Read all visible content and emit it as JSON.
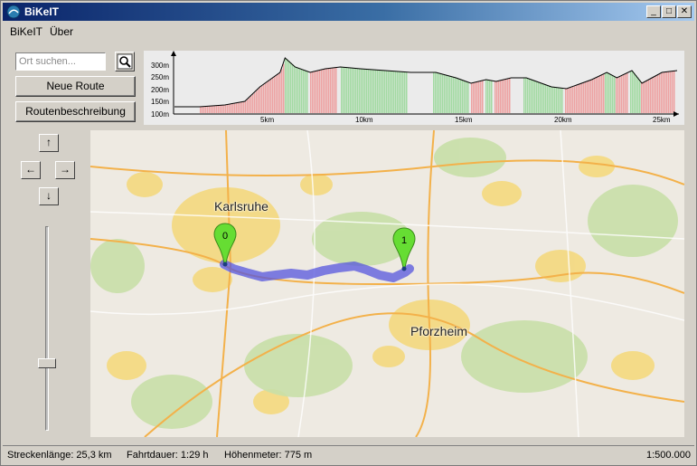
{
  "window": {
    "title": "BiKeIT",
    "minimize": "_",
    "maximize": "□",
    "close": "✕"
  },
  "menu": [
    {
      "label": "BiKeIT"
    },
    {
      "label": "Über"
    }
  ],
  "search": {
    "placeholder": "Ort suchen..."
  },
  "buttons": {
    "new_route": "Neue Route",
    "route_description": "Routenbeschreibung"
  },
  "nav": {
    "up": "↑",
    "left": "←",
    "right": "→",
    "down": "↓"
  },
  "elevation_profile": {
    "y_ticks": [
      "300m",
      "250m",
      "200m",
      "150m",
      "100m"
    ],
    "x_ticks": [
      "5km",
      "10km",
      "15km",
      "20km",
      "25km"
    ]
  },
  "map": {
    "cities": [
      {
        "name": "Karlsruhe"
      },
      {
        "name": "Pforzheim"
      }
    ],
    "markers": [
      {
        "label": "0"
      },
      {
        "label": "1"
      }
    ],
    "route_color": "#5555dd",
    "marker_color": "#66dd33"
  },
  "zoom_slider": {
    "level": 0.2
  },
  "status": {
    "distance": "Streckenlänge: 25,3 km",
    "duration": "Fahrtdauer: 1:29 h",
    "elevation": "Höhenmeter: 775 m",
    "scale": "1:500.000"
  }
}
